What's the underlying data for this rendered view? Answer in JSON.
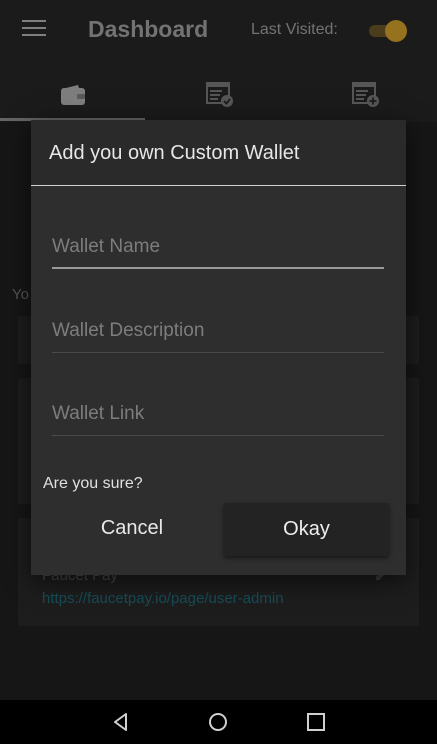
{
  "header": {
    "title": "Dashboard",
    "last_visited_label": "Last Visited:",
    "toggle_on": true
  },
  "tabs": [
    {
      "name": "wallet",
      "icon": "wallet-icon",
      "selected": true
    },
    {
      "name": "checklist",
      "icon": "list-check-icon",
      "selected": false
    },
    {
      "name": "add-list",
      "icon": "list-add-icon",
      "selected": false
    }
  ],
  "background": {
    "partial_text": "Yo",
    "wallet_item_name": "Faucet Pay",
    "wallet_item_link": "https://faucetpay.io/page/user-admin"
  },
  "dialog": {
    "title": "Add you own Custom Wallet",
    "fields": {
      "name_placeholder": "Wallet Name",
      "description_placeholder": "Wallet Description",
      "link_placeholder": "Wallet Link"
    },
    "confirm_text": "Are you sure?",
    "cancel_label": "Cancel",
    "okay_label": "Okay"
  },
  "colors": {
    "accent": "#b88a25",
    "link": "#1c5f6b"
  }
}
